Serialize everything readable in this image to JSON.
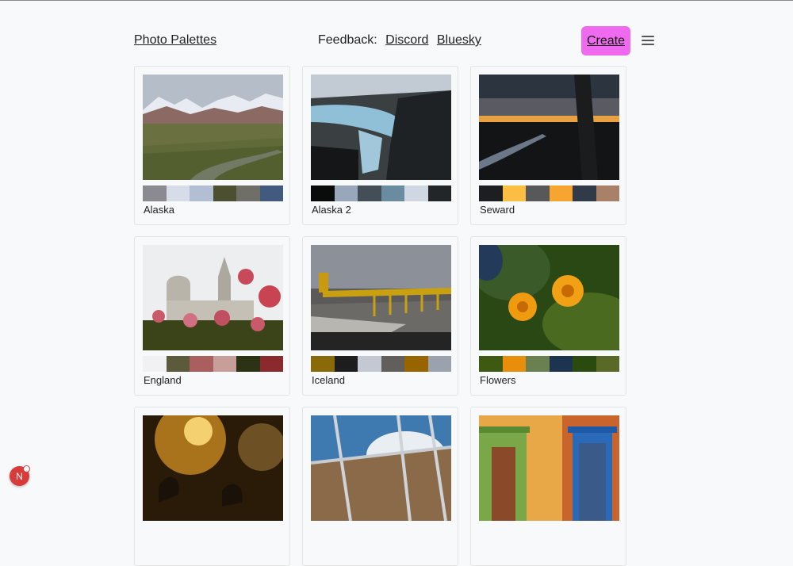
{
  "header": {
    "brand": "Photo Palettes",
    "feedback_label": "Feedback:",
    "links": [
      "Discord",
      "Bluesky"
    ],
    "create_label": "Create",
    "menu_icon": "hamburger-menu-icon"
  },
  "cards": [
    {
      "title": "Alaska",
      "swatches": [
        "#8a8a90",
        "#d6dde8",
        "#b2bfd2",
        "#4c5030",
        "#6f6e67",
        "#435a80"
      ]
    },
    {
      "title": "Alaska 2",
      "swatches": [
        "#0a0c0c",
        "#98a8ba",
        "#444e56",
        "#6a8ca0",
        "#cfd8e2",
        "#222628"
      ]
    },
    {
      "title": "Seward",
      "swatches": [
        "#1c1e22",
        "#fbbe42",
        "#58585a",
        "#f5a530",
        "#313b48",
        "#a98068"
      ]
    },
    {
      "title": "England",
      "swatches": [
        "#f1f1f3",
        "#5b5a3a",
        "#aa5e5e",
        "#c79e9a",
        "#2c3214",
        "#8a2a2c"
      ]
    },
    {
      "title": "Iceland",
      "swatches": [
        "#8a6a08",
        "#1d1d1e",
        "#c3c8d2",
        "#615e5c",
        "#986400",
        "#9aa2ae"
      ]
    },
    {
      "title": "Flowers",
      "swatches": [
        "#3e5a12",
        "#e88e0a",
        "#6a8050",
        "#1c3450",
        "#2a4a10",
        "#5a6a26"
      ]
    },
    {
      "title": "",
      "swatches": []
    },
    {
      "title": "",
      "swatches": []
    },
    {
      "title": "",
      "swatches": []
    }
  ],
  "avatar": {
    "initial": "N"
  }
}
